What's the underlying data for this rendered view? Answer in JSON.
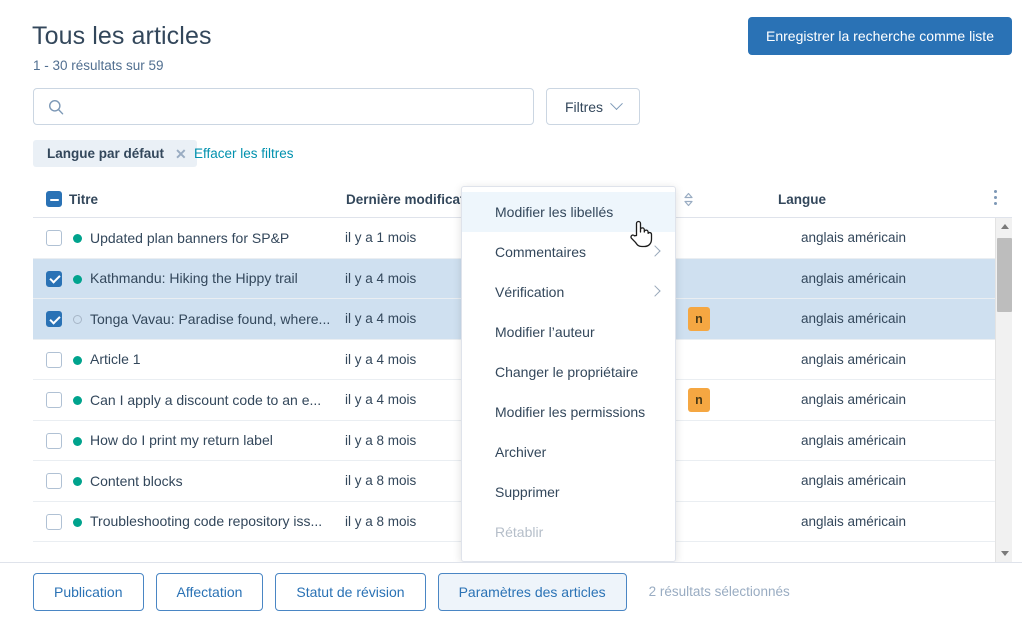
{
  "header": {
    "title": "Tous les articles",
    "result_count": "1 - 30 résultats sur 59",
    "save_search_label": "Enregistrer la recherche comme liste"
  },
  "search": {
    "value": "",
    "placeholder": "",
    "icon": "search-icon"
  },
  "filters_button": {
    "label": "Filtres",
    "icon": "chevron-down-icon"
  },
  "filter_chip": {
    "label": "Langue par défaut",
    "remove_icon": "close-icon"
  },
  "clear_filters_label": "Effacer les filtres",
  "table": {
    "columns": {
      "title": "Titre",
      "last_modified": "Dernière modification",
      "language": "Langue"
    },
    "sort_icon": "sort-updown-icon",
    "kebab_icon": "more-vertical-icon",
    "header_checkbox_state": "indeterminate",
    "rows": [
      {
        "selected": false,
        "status": "published",
        "title": "Updated plan banners for SP&P",
        "last_modified": "il y a 1 mois",
        "badge": "",
        "language": "anglais américain"
      },
      {
        "selected": true,
        "status": "published",
        "title": "Kathmandu: Hiking the Hippy trail",
        "last_modified": "il y a 4 mois",
        "badge": "",
        "language": "anglais américain"
      },
      {
        "selected": true,
        "status": "draft",
        "title": "Tonga Vavau: Paradise found, where...",
        "last_modified": "il y a 4 mois",
        "badge": "n",
        "language": "anglais américain"
      },
      {
        "selected": false,
        "status": "published",
        "title": "Article 1",
        "last_modified": "il y a 4 mois",
        "badge": "",
        "language": "anglais américain"
      },
      {
        "selected": false,
        "status": "published",
        "title": "Can I apply a discount code to an e...",
        "last_modified": "il y a 4 mois",
        "badge": "n",
        "language": "anglais américain"
      },
      {
        "selected": false,
        "status": "published",
        "title": "How do I print my return label",
        "last_modified": "il y a 8 mois",
        "badge": "",
        "language": "anglais américain"
      },
      {
        "selected": false,
        "status": "published",
        "title": "Content blocks",
        "last_modified": "il y a 8 mois",
        "badge": "",
        "language": "anglais américain"
      },
      {
        "selected": false,
        "status": "published",
        "title": "Troubleshooting code repository iss...",
        "last_modified": "il y a 8 mois",
        "badge": "",
        "language": "anglais américain"
      }
    ]
  },
  "context_menu": {
    "items": [
      {
        "label": "Modifier les libellés",
        "submenu": false,
        "highlight": true,
        "disabled": false
      },
      {
        "label": "Commentaires",
        "submenu": true,
        "highlight": false,
        "disabled": false
      },
      {
        "label": "Vérification",
        "submenu": true,
        "highlight": false,
        "disabled": false
      },
      {
        "label": "Modifier l’auteur",
        "submenu": false,
        "highlight": false,
        "disabled": false
      },
      {
        "label": "Changer le propriétaire",
        "submenu": false,
        "highlight": false,
        "disabled": false
      },
      {
        "label": "Modifier les permissions",
        "submenu": false,
        "highlight": false,
        "disabled": false
      },
      {
        "label": "Archiver",
        "submenu": false,
        "highlight": false,
        "disabled": false
      },
      {
        "label": "Supprimer",
        "submenu": false,
        "highlight": false,
        "disabled": false
      },
      {
        "label": "Rétablir",
        "submenu": false,
        "highlight": false,
        "disabled": true
      }
    ]
  },
  "bottom_bar": {
    "buttons": [
      {
        "label": "Publication",
        "active": false
      },
      {
        "label": "Affectation",
        "active": false
      },
      {
        "label": "Statut de révision",
        "active": false
      },
      {
        "label": "Paramètres des articles",
        "active": true
      }
    ],
    "selection_text": "2 résultats sélectionnés"
  },
  "colors": {
    "primary": "#2a72b5",
    "link": "#0091ae",
    "selected_row": "#cfe0f0",
    "status_published": "#00a38d",
    "badge_orange": "#f5a742",
    "text": "#33475b"
  },
  "cursor": {
    "type": "pointer-hand-cursor"
  }
}
